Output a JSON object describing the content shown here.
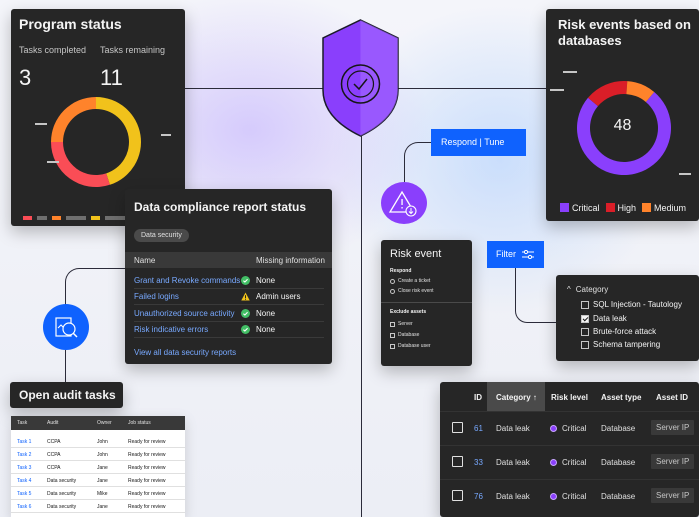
{
  "program_status": {
    "title": "Program status",
    "completed_label": "Tasks completed",
    "completed_value": "3",
    "remaining_label": "Tasks remaining",
    "remaining_value": "11",
    "segments": [
      {
        "name": "yellow",
        "value": 45,
        "color": "#f1c21b"
      },
      {
        "name": "red",
        "value": 30,
        "color": "#fa4d56"
      },
      {
        "name": "orange",
        "value": 25,
        "color": "#ff832b"
      }
    ]
  },
  "risk_events": {
    "title": "Risk events based on databases",
    "total": "48",
    "segments": [
      {
        "name": "Critical",
        "value": 75,
        "color": "#8a3ffc"
      },
      {
        "name": "High",
        "value": 15,
        "color": "#da1e28"
      },
      {
        "name": "Medium",
        "value": 10,
        "color": "#ff832b"
      }
    ],
    "legend": [
      {
        "label": "Critical",
        "color": "#8a3ffc"
      },
      {
        "label": "High",
        "color": "#da1e28"
      },
      {
        "label": "Medium",
        "color": "#ff832b"
      }
    ]
  },
  "compliance": {
    "title": "Data compliance report status",
    "chip": "Data security",
    "col_name": "Name",
    "col_missing": "Missing information",
    "rows": [
      {
        "name": "Grant and Revoke commands",
        "status": "None",
        "icon": "check-icon"
      },
      {
        "name": "Failed logins",
        "status": "Admin users",
        "icon": "warning-icon"
      },
      {
        "name": "Unauthorized source activity",
        "status": "None",
        "icon": "check-icon"
      },
      {
        "name": "Risk indicative errors",
        "status": "None",
        "icon": "check-icon"
      }
    ],
    "view_all": "View all data security reports"
  },
  "respond_button": "Respond | Tune",
  "risk_event": {
    "title": "Risk event",
    "respond_heading": "Respond",
    "respond_options": [
      "Create a ticket",
      "Close risk event"
    ],
    "exclude_heading": "Exclude assets",
    "exclude_options": [
      "Server",
      "Database",
      "Database user"
    ]
  },
  "filter_button": "Filter",
  "category": {
    "header": "Category",
    "options": [
      {
        "label": "SQL Injection - Tautology",
        "checked": false
      },
      {
        "label": "Data leak",
        "checked": true
      },
      {
        "label": "Brute-force attack",
        "checked": false
      },
      {
        "label": "Schema tampering",
        "checked": false
      }
    ]
  },
  "audit": {
    "title": "Open audit tasks",
    "columns": [
      "Task",
      "Audit",
      "Owner",
      "Job status"
    ],
    "rows": [
      [
        "Task 1",
        "CCPA",
        "John",
        "Ready for review"
      ],
      [
        "Task 2",
        "CCPA",
        "John",
        "Ready for review"
      ],
      [
        "Task 3",
        "CCPA",
        "Jane",
        "Ready for review"
      ],
      [
        "Task 4",
        "Data security",
        "Jane",
        "Ready for review"
      ],
      [
        "Task 5",
        "Data security",
        "Mike",
        "Ready for review"
      ],
      [
        "Task 6",
        "Data security",
        "Jane",
        "Ready for review"
      ]
    ]
  },
  "big_table": {
    "columns": {
      "id": "ID",
      "category": "Category ↑",
      "risk": "Risk level",
      "asset_type": "Asset type",
      "asset_id": "Asset ID"
    },
    "rows": [
      {
        "id": "61",
        "category": "Data leak",
        "risk": "Critical",
        "asset_type": "Database",
        "asset_id": "Server IP"
      },
      {
        "id": "33",
        "category": "Data leak",
        "risk": "Critical",
        "asset_type": "Database",
        "asset_id": "Server IP"
      },
      {
        "id": "76",
        "category": "Data leak",
        "risk": "Critical",
        "asset_type": "Database",
        "asset_id": "Server IP"
      }
    ]
  },
  "colors": {
    "accent_blue": "#0f62fe",
    "accent_purple": "#8a3ffc",
    "card_bg": "#262626"
  }
}
